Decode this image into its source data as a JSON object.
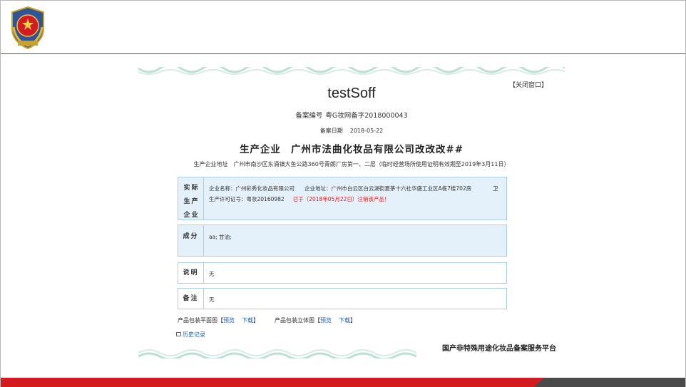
{
  "doc": {
    "close_label": "【关闭窗口】",
    "product_name": "testSoff",
    "reg_label": "备案编号",
    "reg_number": "粤G妆网备字2018000043",
    "date_label": "备案日期",
    "date_value": "2018-05-22",
    "producer_label": "生产企业",
    "producer_name": "广州市法曲化妆品有限公司改改改##",
    "address_label": "生产企业地址",
    "address_value": "广州市南沙区东涌镇大鱼公路360号青朗厂房第一、二层（临时经营场所使用证明有效期至2019年3月11日）"
  },
  "actual_producer": {
    "label": "实际生产企业",
    "company": "企业名称：广州彩秀化妆品有限公司",
    "address": "企业地址：广州市白云区白云湖街夏茅十六社华盛工业区A栋7楼702房",
    "tail": "卫",
    "license": "生产许可证号：粤妆20160982",
    "cancel_notice": "已于（2018年05月22日）注销该产品！"
  },
  "ingredients": {
    "label": "成分",
    "value": "aa; 甘油;"
  },
  "description": {
    "label": "说明",
    "value": "无"
  },
  "remarks": {
    "label": "备注",
    "value": "无"
  },
  "packaging": {
    "flat_label": "产品包装平面图",
    "stereo_label": "产品包装立体图",
    "bracket_open": "【",
    "bracket_close": "】",
    "preview": "预览",
    "download": "下载"
  },
  "history_label": "历史记录",
  "platform_label": "国产非特殊用途化妆品备案服务平台",
  "colors": {
    "brand_red": "#d21c22",
    "link_blue": "#1a5aa8",
    "box_blue": "#e4f1fb",
    "notice_red": "#e0201c"
  }
}
